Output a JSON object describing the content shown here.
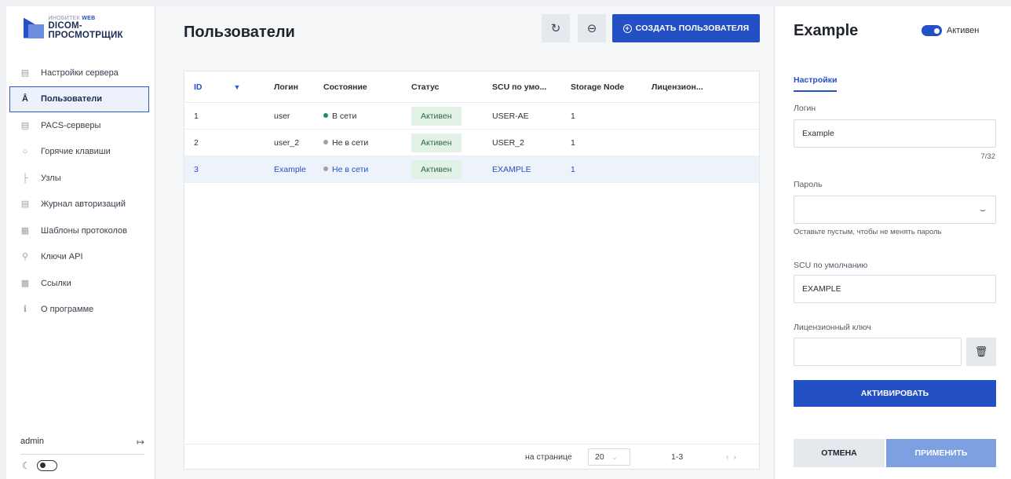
{
  "logo": {
    "prefix": "ИНОБИТЕК",
    "prefix_accent": "WEB",
    "name": "DICOM-ПРОСМОТРЩИК"
  },
  "sidebar": {
    "items": [
      {
        "label": "Настройки сервера",
        "icon": "server-icon",
        "active": false
      },
      {
        "label": "Пользователи",
        "icon": "users-icon",
        "active": true
      },
      {
        "label": "PACS-серверы",
        "icon": "pacs-icon",
        "active": false
      },
      {
        "label": "Горячие клавиши",
        "icon": "keyboard-icon",
        "active": false
      },
      {
        "label": "Узлы",
        "icon": "nodes-icon",
        "active": false
      },
      {
        "label": "Журнал авторизаций",
        "icon": "log-icon",
        "active": false
      },
      {
        "label": "Шаблоны протоколов",
        "icon": "template-icon",
        "active": false
      },
      {
        "label": "Ключи API",
        "icon": "key-icon",
        "active": false
      },
      {
        "label": "Ссылки",
        "icon": "links-icon",
        "active": false
      },
      {
        "label": "О программе",
        "icon": "info-icon",
        "active": false
      }
    ],
    "user": "admin"
  },
  "main": {
    "title": "Пользователи",
    "create_label": "СОЗДАТЬ ПОЛЬЗОВАТЕЛЯ",
    "columns": [
      "ID",
      "Логин",
      "Состояние",
      "Статус",
      "SCU по умо...",
      "Storage Node",
      "Лицензион..."
    ],
    "rows": [
      {
        "id": "1",
        "login": "user",
        "state": "В сети",
        "state_color": "#2e8b57",
        "status": "Активен",
        "scu": "USER-AE",
        "node": "1",
        "license": ""
      },
      {
        "id": "2",
        "login": "user_2",
        "state": "Не в сети",
        "state_color": "#9aa2ae",
        "status": "Активен",
        "scu": "USER_2",
        "node": "1",
        "license": ""
      },
      {
        "id": "3",
        "login": "Example",
        "state": "Не в сети",
        "state_color": "#9aa2ae",
        "status": "Активен",
        "scu": "EXAMPLE",
        "node": "1",
        "license": ""
      }
    ],
    "selected_row": 2,
    "footer": {
      "per_page_label": "на странице",
      "per_page": "20",
      "range": "1-3"
    }
  },
  "panel": {
    "title": "Example",
    "active_label": "Активен",
    "tab": "Настройки",
    "login_label": "Логин",
    "login_value": "Example",
    "login_counter": "7/32",
    "password_label": "Пароль",
    "password_value": "",
    "password_hint": "Оставьте пустым, чтобы не менять пароль",
    "scu_label": "SCU по умолчанию",
    "scu_value": "EXAMPLE",
    "license_label": "Лицензионный ключ",
    "license_value": "",
    "activate_label": "АКТИВИРОВАТЬ",
    "cancel_label": "ОТМЕНА",
    "apply_label": "ПРИМЕНИТЬ"
  },
  "colors": {
    "accent": "#2450c5",
    "online": "#2e8b57",
    "offline": "#9aa2ae",
    "badge_bg": "#e3f2e6"
  }
}
